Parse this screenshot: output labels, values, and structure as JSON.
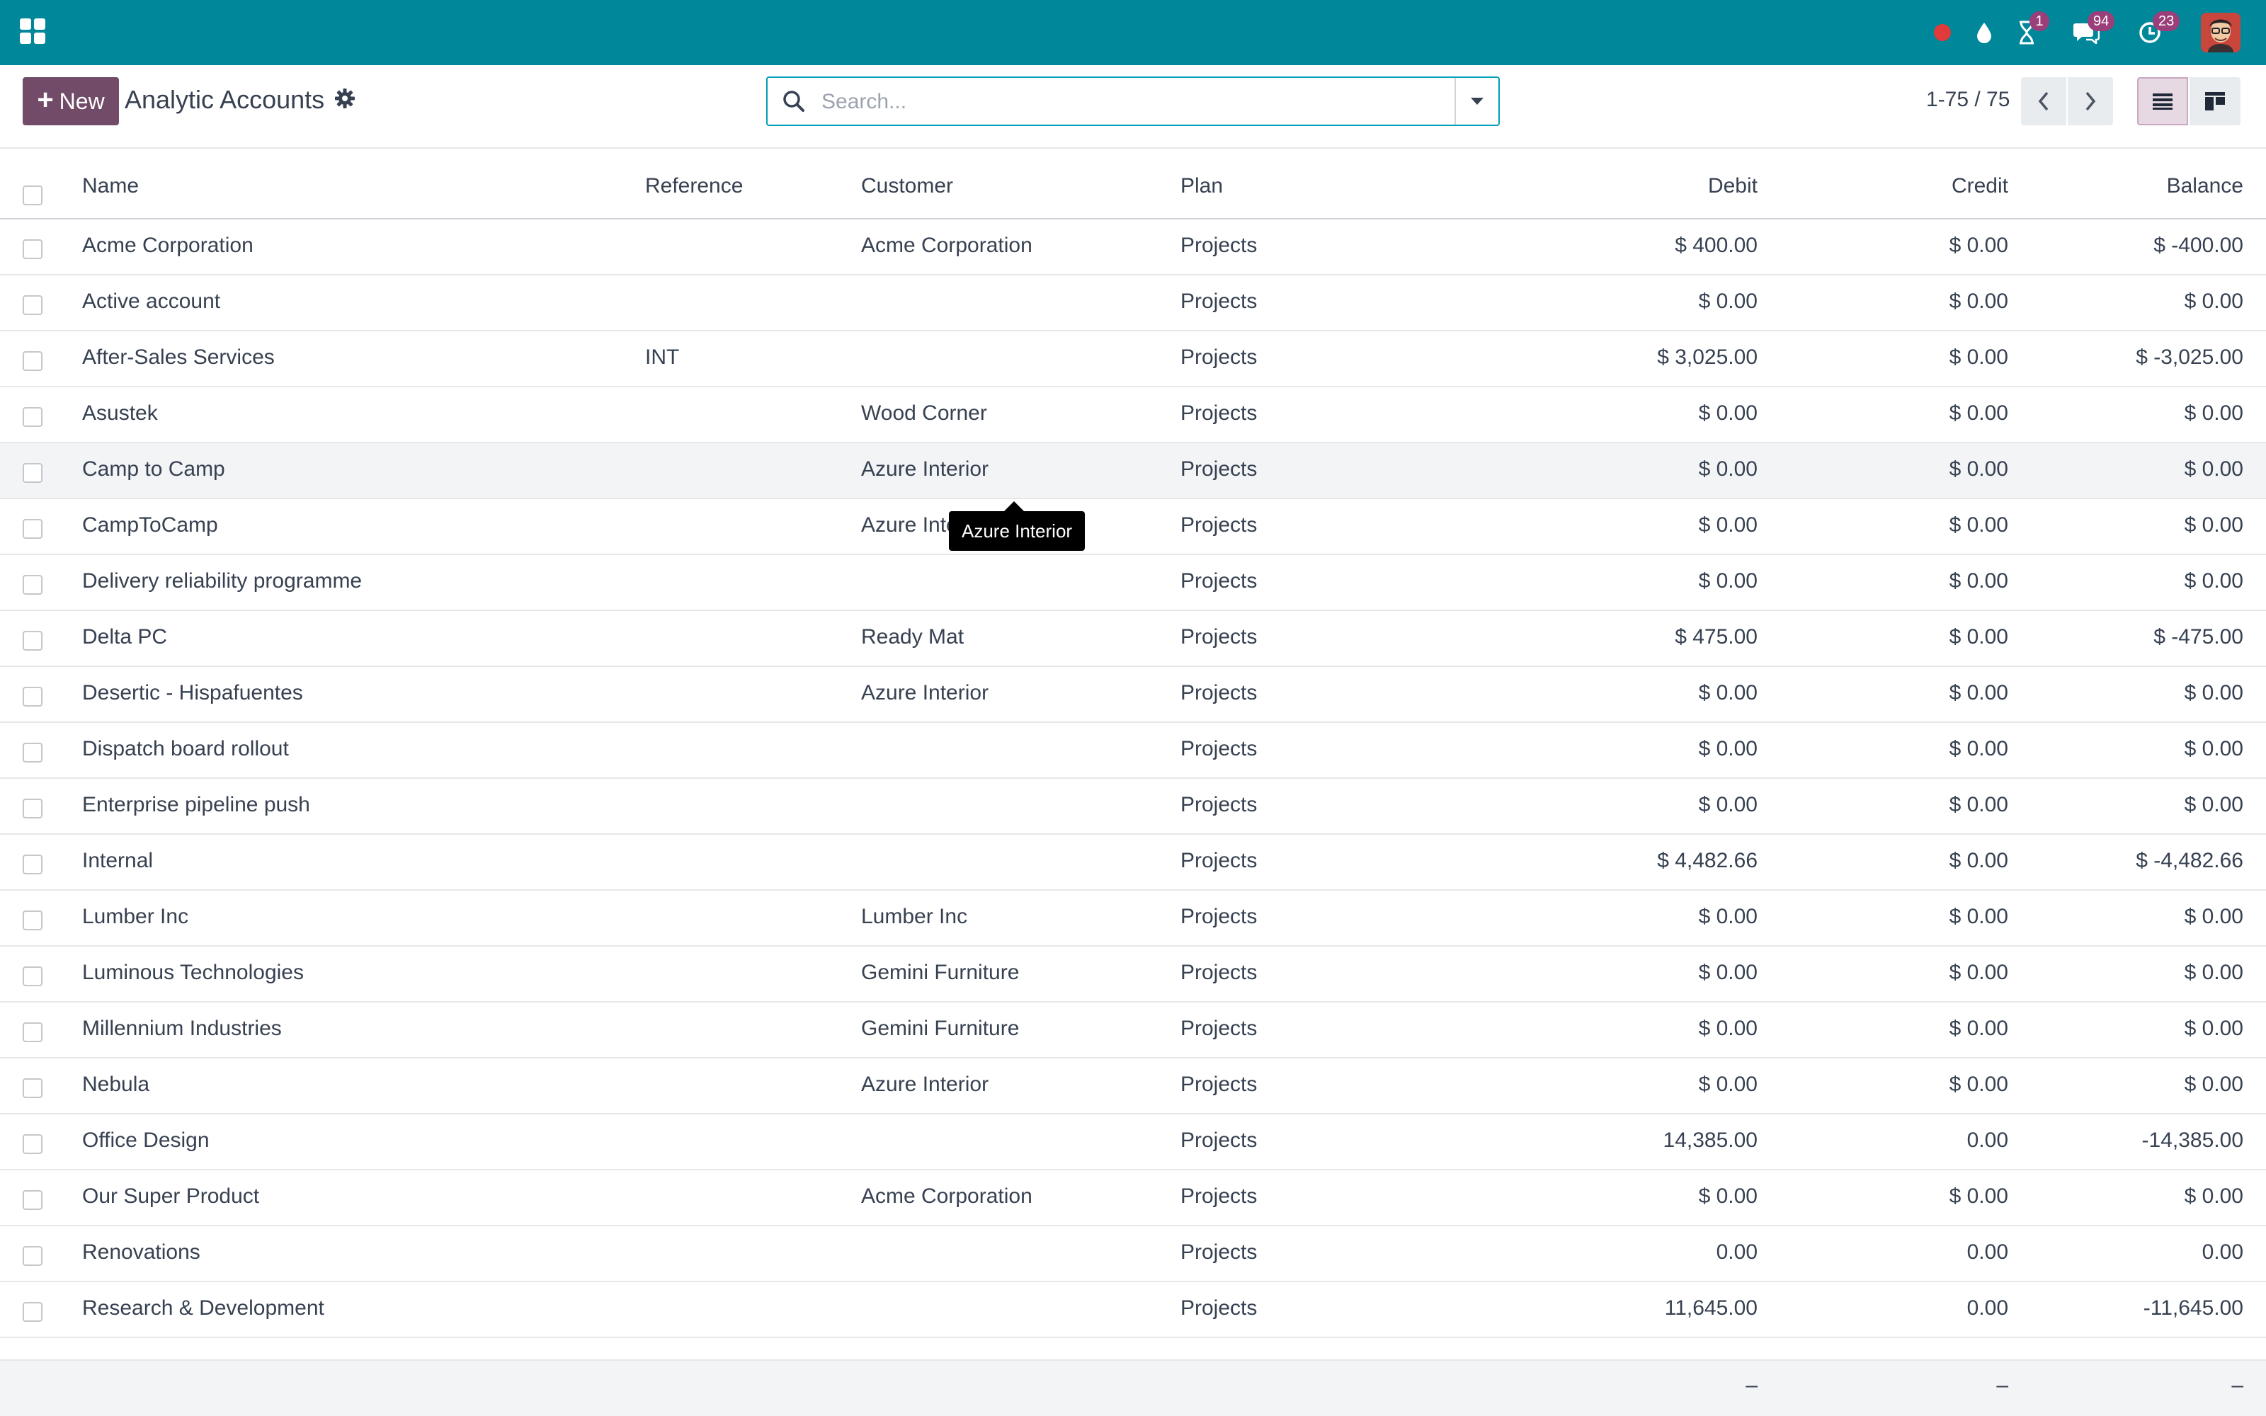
{
  "navbar": {
    "brand_color": "#00879a",
    "icons": [
      "apps-icon",
      "record-icon",
      "drop-icon",
      "hourglass-icon",
      "chat-icon",
      "clock-icon"
    ],
    "activities_badge": "1",
    "messages_badge": "94",
    "clock_badge": "23",
    "accent_color": "#714b67"
  },
  "control": {
    "new_label": "New",
    "title": "Analytic Accounts",
    "search_placeholder": "Search...",
    "pager": "1-75 / 75"
  },
  "table": {
    "columns": [
      "Name",
      "Reference",
      "Customer",
      "Plan",
      "Debit",
      "Credit",
      "Balance"
    ],
    "rows": [
      {
        "name": "Acme Corporation",
        "ref": "",
        "customer": "Acme Corporation",
        "plan": "Projects",
        "debit": "$ 400.00",
        "credit": "$ 0.00",
        "balance": "$ -400.00"
      },
      {
        "name": "Active account",
        "ref": "",
        "customer": "",
        "plan": "Projects",
        "debit": "$ 0.00",
        "credit": "$ 0.00",
        "balance": "$ 0.00"
      },
      {
        "name": "After-Sales Services",
        "ref": "INT",
        "customer": "",
        "plan": "Projects",
        "debit": "$ 3,025.00",
        "credit": "$ 0.00",
        "balance": "$ -3,025.00"
      },
      {
        "name": "Asustek",
        "ref": "",
        "customer": "Wood Corner",
        "plan": "Projects",
        "debit": "$ 0.00",
        "credit": "$ 0.00",
        "balance": "$ 0.00"
      },
      {
        "name": "Camp to Camp",
        "ref": "",
        "customer": "Azure Interior",
        "plan": "Projects",
        "debit": "$ 0.00",
        "credit": "$ 0.00",
        "balance": "$ 0.00"
      },
      {
        "name": "CampToCamp",
        "ref": "",
        "customer": "Azure Inte",
        "plan": "Projects",
        "debit": "$ 0.00",
        "credit": "$ 0.00",
        "balance": "$ 0.00"
      },
      {
        "name": "Delivery reliability programme",
        "ref": "",
        "customer": "",
        "plan": "Projects",
        "debit": "$ 0.00",
        "credit": "$ 0.00",
        "balance": "$ 0.00"
      },
      {
        "name": "Delta PC",
        "ref": "",
        "customer": "Ready Mat",
        "plan": "Projects",
        "debit": "$ 475.00",
        "credit": "$ 0.00",
        "balance": "$ -475.00"
      },
      {
        "name": "Desertic - Hispafuentes",
        "ref": "",
        "customer": "Azure Interior",
        "plan": "Projects",
        "debit": "$ 0.00",
        "credit": "$ 0.00",
        "balance": "$ 0.00"
      },
      {
        "name": "Dispatch board rollout",
        "ref": "",
        "customer": "",
        "plan": "Projects",
        "debit": "$ 0.00",
        "credit": "$ 0.00",
        "balance": "$ 0.00"
      },
      {
        "name": "Enterprise pipeline push",
        "ref": "",
        "customer": "",
        "plan": "Projects",
        "debit": "$ 0.00",
        "credit": "$ 0.00",
        "balance": "$ 0.00"
      },
      {
        "name": "Internal",
        "ref": "",
        "customer": "",
        "plan": "Projects",
        "debit": "$ 4,482.66",
        "credit": "$ 0.00",
        "balance": "$ -4,482.66"
      },
      {
        "name": "Lumber Inc",
        "ref": "",
        "customer": "Lumber Inc",
        "plan": "Projects",
        "debit": "$ 0.00",
        "credit": "$ 0.00",
        "balance": "$ 0.00"
      },
      {
        "name": "Luminous Technologies",
        "ref": "",
        "customer": "Gemini Furniture",
        "plan": "Projects",
        "debit": "$ 0.00",
        "credit": "$ 0.00",
        "balance": "$ 0.00"
      },
      {
        "name": "Millennium Industries",
        "ref": "",
        "customer": "Gemini Furniture",
        "plan": "Projects",
        "debit": "$ 0.00",
        "credit": "$ 0.00",
        "balance": "$ 0.00"
      },
      {
        "name": "Nebula",
        "ref": "",
        "customer": "Azure Interior",
        "plan": "Projects",
        "debit": "$ 0.00",
        "credit": "$ 0.00",
        "balance": "$ 0.00"
      },
      {
        "name": "Office Design",
        "ref": "",
        "customer": "",
        "plan": "Projects",
        "debit": "14,385.00",
        "credit": "0.00",
        "balance": "-14,385.00"
      },
      {
        "name": "Our Super Product",
        "ref": "",
        "customer": "Acme Corporation",
        "plan": "Projects",
        "debit": "$ 0.00",
        "credit": "$ 0.00",
        "balance": "$ 0.00"
      },
      {
        "name": "Renovations",
        "ref": "",
        "customer": "",
        "plan": "Projects",
        "debit": "0.00",
        "credit": "0.00",
        "balance": "0.00"
      },
      {
        "name": "Research & Development",
        "ref": "",
        "customer": "",
        "plan": "Projects",
        "debit": "11,645.00",
        "credit": "0.00",
        "balance": "-11,645.00"
      }
    ]
  },
  "tooltip": {
    "text": "Azure Interior"
  },
  "footer": {
    "debit_total": "–",
    "credit_total": "–",
    "balance_total": "–"
  }
}
